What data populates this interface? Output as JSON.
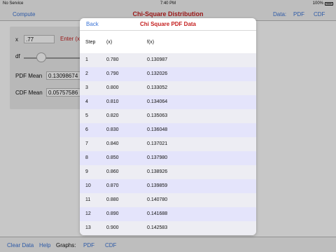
{
  "status": {
    "carrier": "No Service",
    "time": "7:40 PM",
    "battery": "100%"
  },
  "nav": {
    "compute": "Compute",
    "title": "Chi-Square Distribution",
    "data_label": "Data:",
    "pdf": "PDF",
    "cdf": "CDF"
  },
  "panel": {
    "x_label": "x",
    "x_value": ".77",
    "enter_hint": "Enter (x.",
    "df_label": "df",
    "pdf_mean_label": "PDF Mean",
    "pdf_mean_value": "0.13098674",
    "cdf_mean_label": "CDF Mean",
    "cdf_mean_value": "0.05757586"
  },
  "toolbar": {
    "clear": "Clear Data",
    "help": "Help",
    "graphs": "Graphs:",
    "pdf": "PDF",
    "cdf": "CDF"
  },
  "modal": {
    "back": "Back",
    "title": "Chi Square PDF Data",
    "headers": {
      "step": "Step",
      "x": "(x)",
      "fx": "f(x)"
    },
    "rows": [
      {
        "step": "1",
        "x": "0.780",
        "fx": "0.130987"
      },
      {
        "step": "2",
        "x": "0.790",
        "fx": "0.132026"
      },
      {
        "step": "3",
        "x": "0.800",
        "fx": "0.133052"
      },
      {
        "step": "4",
        "x": "0.810",
        "fx": "0.134064"
      },
      {
        "step": "5",
        "x": "0.820",
        "fx": "0.135063"
      },
      {
        "step": "6",
        "x": "0.830",
        "fx": "0.136048"
      },
      {
        "step": "7",
        "x": "0.840",
        "fx": "0.137021"
      },
      {
        "step": "8",
        "x": "0.850",
        "fx": "0.137980"
      },
      {
        "step": "9",
        "x": "0.860",
        "fx": "0.138926"
      },
      {
        "step": "10",
        "x": "0.870",
        "fx": "0.139859"
      },
      {
        "step": "11",
        "x": "0.880",
        "fx": "0.140780"
      },
      {
        "step": "12",
        "x": "0.890",
        "fx": "0.141688"
      },
      {
        "step": "13",
        "x": "0.900",
        "fx": "0.142583"
      }
    ]
  }
}
